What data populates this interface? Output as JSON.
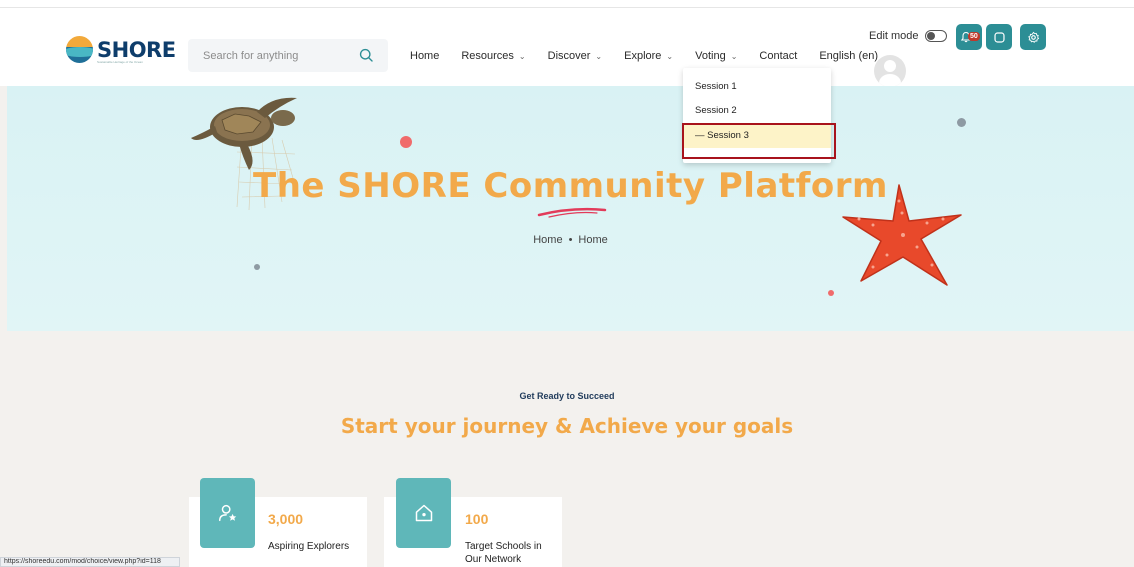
{
  "header": {
    "logo_text": "SHORE",
    "logo_subtext": "Sustainable Heritage of the Ocean",
    "search_placeholder": "Search for anything",
    "nav": [
      {
        "label": "Home"
      },
      {
        "label": "Resources"
      },
      {
        "label": "Discover"
      },
      {
        "label": "Explore"
      },
      {
        "label": "Voting"
      },
      {
        "label": "Contact"
      },
      {
        "label": "English (en)"
      }
    ],
    "edit_mode_label": "Edit mode",
    "notification_count": "50"
  },
  "dropdown": {
    "items": [
      "Session 1",
      "Session 2",
      "— Session 3"
    ]
  },
  "hero": {
    "title": "The SHORE Community Platform",
    "breadcrumb": [
      "Home",
      "Home"
    ],
    "breadcrumb_separator": "•"
  },
  "section": {
    "kicker": "Get Ready to Succeed",
    "headline": "Start your journey & Achieve your goals"
  },
  "stats": [
    {
      "value": "3,000",
      "label": "Aspiring Explorers",
      "icon": "user-star-icon"
    },
    {
      "value": "100",
      "label": "Target Schools in Our Network",
      "icon": "home-icon"
    }
  ],
  "status_bar_url": "https://shoreedu.com/mod/choice/view.php?id=118",
  "colors": {
    "accent": "#f2a94a",
    "teal": "#2c8e95",
    "hero_bg": "#d9f2f4",
    "highlight": "#a8131c"
  }
}
